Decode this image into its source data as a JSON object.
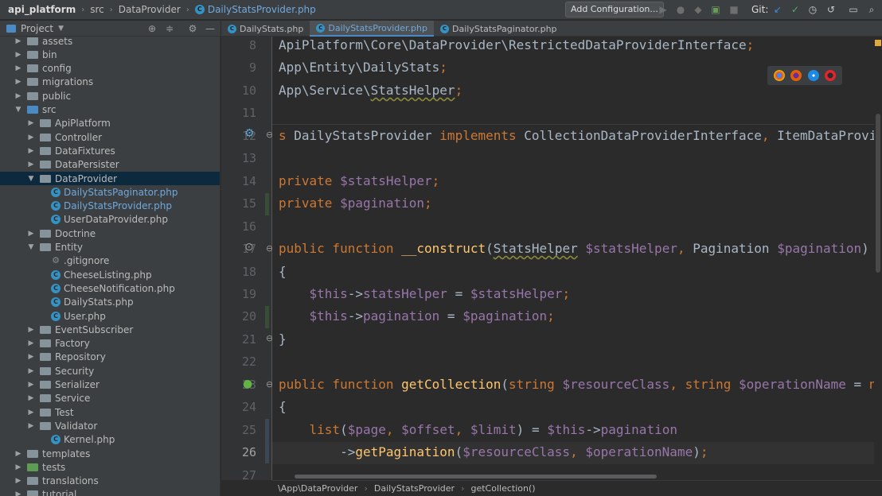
{
  "topbar": {
    "project": "api_platform",
    "crumb_src": "src",
    "crumb_dir": "DataProvider",
    "crumb_file": "DailyStatsProvider.php",
    "add_config": "Add Configuration...",
    "git_label": "Git:"
  },
  "project_panel": {
    "title": "Project",
    "tree": [
      {
        "label": "assets",
        "type": "folder",
        "depth": 1,
        "arrow": "▶"
      },
      {
        "label": "bin",
        "type": "folder",
        "depth": 1,
        "arrow": "▶"
      },
      {
        "label": "config",
        "type": "folder",
        "depth": 1,
        "arrow": "▶"
      },
      {
        "label": "migrations",
        "type": "folder",
        "depth": 1,
        "arrow": "▶"
      },
      {
        "label": "public",
        "type": "folder",
        "depth": 1,
        "arrow": "▶"
      },
      {
        "label": "src",
        "type": "src",
        "depth": 1,
        "arrow": "▼"
      },
      {
        "label": "ApiPlatform",
        "type": "folder",
        "depth": 2,
        "arrow": "▶"
      },
      {
        "label": "Controller",
        "type": "folder",
        "depth": 2,
        "arrow": "▶"
      },
      {
        "label": "DataFixtures",
        "type": "folder",
        "depth": 2,
        "arrow": "▶"
      },
      {
        "label": "DataPersister",
        "type": "folder",
        "depth": 2,
        "arrow": "▶"
      },
      {
        "label": "DataProvider",
        "type": "folder",
        "depth": 2,
        "arrow": "▼",
        "selected": true
      },
      {
        "label": "DailyStatsPaginator.php",
        "type": "class",
        "depth": 3,
        "blue": true
      },
      {
        "label": "DailyStatsProvider.php",
        "type": "class",
        "depth": 3,
        "blue": true
      },
      {
        "label": "UserDataProvider.php",
        "type": "class",
        "depth": 3
      },
      {
        "label": "Doctrine",
        "type": "folder",
        "depth": 2,
        "arrow": "▶"
      },
      {
        "label": "Entity",
        "type": "folder",
        "depth": 2,
        "arrow": "▼"
      },
      {
        "label": ".gitignore",
        "type": "git",
        "depth": 3
      },
      {
        "label": "CheeseListing.php",
        "type": "class",
        "depth": 3
      },
      {
        "label": "CheeseNotification.php",
        "type": "class",
        "depth": 3
      },
      {
        "label": "DailyStats.php",
        "type": "class",
        "depth": 3
      },
      {
        "label": "User.php",
        "type": "class",
        "depth": 3
      },
      {
        "label": "EventSubscriber",
        "type": "folder",
        "depth": 2,
        "arrow": "▶"
      },
      {
        "label": "Factory",
        "type": "folder",
        "depth": 2,
        "arrow": "▶"
      },
      {
        "label": "Repository",
        "type": "folder",
        "depth": 2,
        "arrow": "▶"
      },
      {
        "label": "Security",
        "type": "folder",
        "depth": 2,
        "arrow": "▶"
      },
      {
        "label": "Serializer",
        "type": "folder",
        "depth": 2,
        "arrow": "▶"
      },
      {
        "label": "Service",
        "type": "folder",
        "depth": 2,
        "arrow": "▶"
      },
      {
        "label": "Test",
        "type": "folder",
        "depth": 2,
        "arrow": "▶"
      },
      {
        "label": "Validator",
        "type": "folder",
        "depth": 2,
        "arrow": "▶"
      },
      {
        "label": "Kernel.php",
        "type": "class",
        "depth": 3
      },
      {
        "label": "templates",
        "type": "folder",
        "depth": 1,
        "arrow": "▶"
      },
      {
        "label": "tests",
        "type": "test",
        "depth": 1,
        "arrow": "▶"
      },
      {
        "label": "translations",
        "type": "folder",
        "depth": 1,
        "arrow": "▶"
      },
      {
        "label": "tutorial",
        "type": "folder",
        "depth": 1,
        "arrow": "▶"
      }
    ]
  },
  "tabs": [
    {
      "label": "DailyStats.php",
      "active": false
    },
    {
      "label": "DailyStatsProvider.php",
      "active": true
    },
    {
      "label": "DailyStatsPaginator.php",
      "active": false
    }
  ],
  "editor": {
    "current_line": "26",
    "lines": [
      {
        "n": "8",
        "html": "ApiPlatform\\Core\\DataProvider\\RestrictedDataProviderInterface<span class=\"k\">;</span>"
      },
      {
        "n": "9",
        "html": "App\\Entity\\DailyStats<span class=\"k\">;</span>"
      },
      {
        "n": "10",
        "html": "App\\Service\\<span class=\"sq\">StatsHelper</span><span class=\"k\">;</span>"
      },
      {
        "n": "11",
        "html": ""
      },
      {
        "n": "12",
        "html": "<span class=\"k\">s</span> DailyStatsProvider <span class=\"k\">implements</span> CollectionDataProviderInterface<span class=\"k\">,</span> ItemDataProvide"
      },
      {
        "n": "13",
        "html": ""
      },
      {
        "n": "14",
        "html": "<span class=\"k\">private</span> <span class=\"v\">$statsHelper</span><span class=\"k\">;</span>"
      },
      {
        "n": "15",
        "html": "<span class=\"k\">private</span> <span class=\"v\">$pagination</span><span class=\"k\">;</span>"
      },
      {
        "n": "16",
        "html": ""
      },
      {
        "n": "17",
        "html": "<span class=\"k\">public function</span> <span class=\"f\">__construct</span>(<span class=\"sq\">StatsHelper</span> <span class=\"v\">$statsHelper</span><span class=\"k\">,</span> Pagination <span class=\"v\">$pagination</span>)"
      },
      {
        "n": "18",
        "html": "{"
      },
      {
        "n": "19",
        "html": "    <span class=\"v\">$this</span>-&gt;<span class=\"v\">statsHelper</span> = <span class=\"v\">$statsHelper</span><span class=\"k\">;</span>"
      },
      {
        "n": "20",
        "html": "    <span class=\"v\">$this</span>-&gt;<span class=\"v\">pagination</span> = <span class=\"v\">$pagination</span><span class=\"k\">;</span>"
      },
      {
        "n": "21",
        "html": "}"
      },
      {
        "n": "22",
        "html": ""
      },
      {
        "n": "23",
        "html": "<span class=\"k\">public function</span> <span class=\"f\">getCollection</span>(<span class=\"k\">string</span> <span class=\"v\">$resourceClass</span><span class=\"k\">,</span> <span class=\"k\">string</span> <span class=\"v\">$operationName</span> = <span class=\"k\">nul</span>"
      },
      {
        "n": "24",
        "html": "{"
      },
      {
        "n": "25",
        "html": "    <span class=\"k\">list</span>(<span class=\"v\">$page</span><span class=\"k\">,</span> <span class=\"v\">$offset</span><span class=\"k\">,</span> <span class=\"v\">$limit</span>) = <span class=\"v\">$this</span>-&gt;<span class=\"v\">pagination</span>"
      },
      {
        "n": "26",
        "html": "        -&gt;<span class=\"f\">getPagination</span>(<span class=\"v\">$resourceClass</span><span class=\"k\">,</span> <span class=\"v\">$operationName</span>)<span class=\"k\">;</span>"
      },
      {
        "n": "27",
        "html": ""
      }
    ]
  },
  "bottom_breadcrumb": {
    "ns": "\\App\\DataProvider",
    "cls": "DailyStatsProvider",
    "method": "getCollection()"
  },
  "icons": {
    "class_file": "c-file-icon",
    "folder": "folder-icon",
    "gear": "gear-icon",
    "target": "locate-icon",
    "collapse": "collapse-icon",
    "minimize": "minimize-icon"
  },
  "colors": {
    "keyword": "#cc7832",
    "variable": "#9876aa",
    "function": "#ffc66d",
    "selection": "#0d293e",
    "accent": "#4a88c7"
  }
}
